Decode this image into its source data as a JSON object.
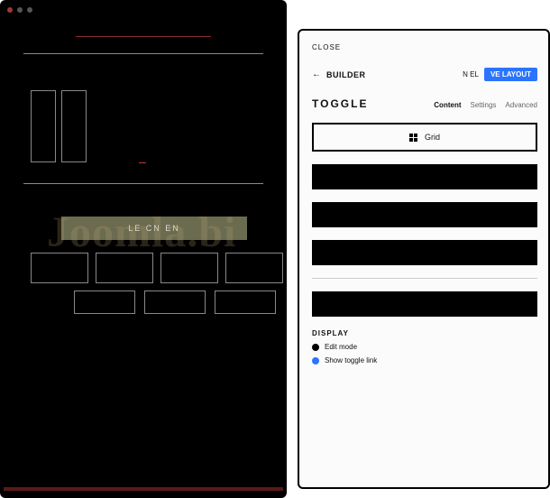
{
  "watermark": "Joomla.bi",
  "canvas": {
    "button_label": "LE CN EN"
  },
  "panel": {
    "close_label": "CLOSE",
    "builder_label": "BUILDER",
    "nel_label": "N EL",
    "save_layout_label": "VE LAYOUT",
    "section_title": "TOGGLE",
    "tabs": {
      "content": "Content",
      "settings": "Settings",
      "advanced": "Advanced"
    },
    "grid_label": "Grid",
    "display": {
      "header": "DISPLAY",
      "option1": "Edit mode",
      "option2": "Show toggle link"
    }
  }
}
